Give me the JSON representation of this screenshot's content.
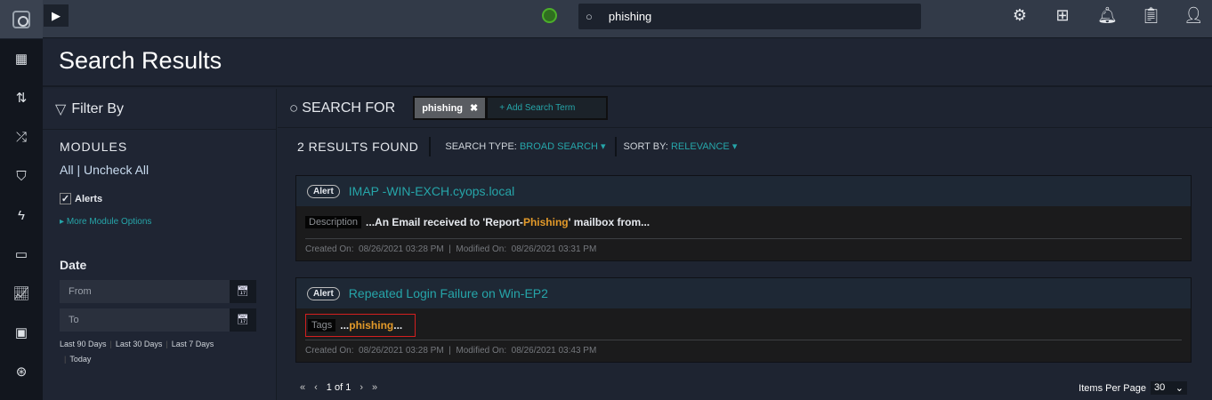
{
  "topbar": {
    "search_value": "phishing",
    "icons": [
      "settings-icon",
      "hierarchy-icon",
      "bell-icon",
      "clipboard-check-icon",
      "user-icon"
    ]
  },
  "header": {
    "title": "Search Results"
  },
  "filter": {
    "title": "Filter By",
    "modules_label": "MODULES",
    "all": "All",
    "uncheck_all": "Uncheck All",
    "alerts_label": "Alerts",
    "alerts_checked": true,
    "more_options": "More Module Options",
    "date_label": "Date",
    "from_placeholder": "From",
    "to_placeholder": "To",
    "quick": [
      "Last 90 Days",
      "Last 30 Days",
      "Last 7 Days",
      "Today"
    ]
  },
  "search": {
    "label": "SEARCH FOR",
    "term": "phishing",
    "add_term": "+ Add Search Term"
  },
  "results": {
    "count": "2 RESULTS FOUND",
    "search_type_label": "SEARCH TYPE:",
    "search_type": "BROAD SEARCH",
    "sort_label": "SORT BY:",
    "sort": "RELEVANCE"
  },
  "cards": [
    {
      "badge": "Alert",
      "title": "IMAP -WIN-EXCH.cyops.local",
      "field": "Description",
      "pre": "...An Email received to 'Report- ",
      "hl": "Phishing",
      "post": " ' mailbox from...",
      "created_label": "Created On:",
      "created": "08/26/2021 03:28 PM",
      "modified_label": "Modified On:",
      "modified": "08/26/2021 03:31 PM"
    },
    {
      "badge": "Alert",
      "title": "Repeated Login Failure on Win-EP2",
      "field": "Tags",
      "pre": "... ",
      "hl": "phishing",
      "post": " ...",
      "created_label": "Created On:",
      "created": "08/26/2021 03:28 PM",
      "modified_label": "Modified On:",
      "modified": "08/26/2021 03:43 PM"
    }
  ],
  "pagination": {
    "page": "1 of 1",
    "items_per_page_label": "Items Per Page",
    "items_per_page": "30"
  }
}
